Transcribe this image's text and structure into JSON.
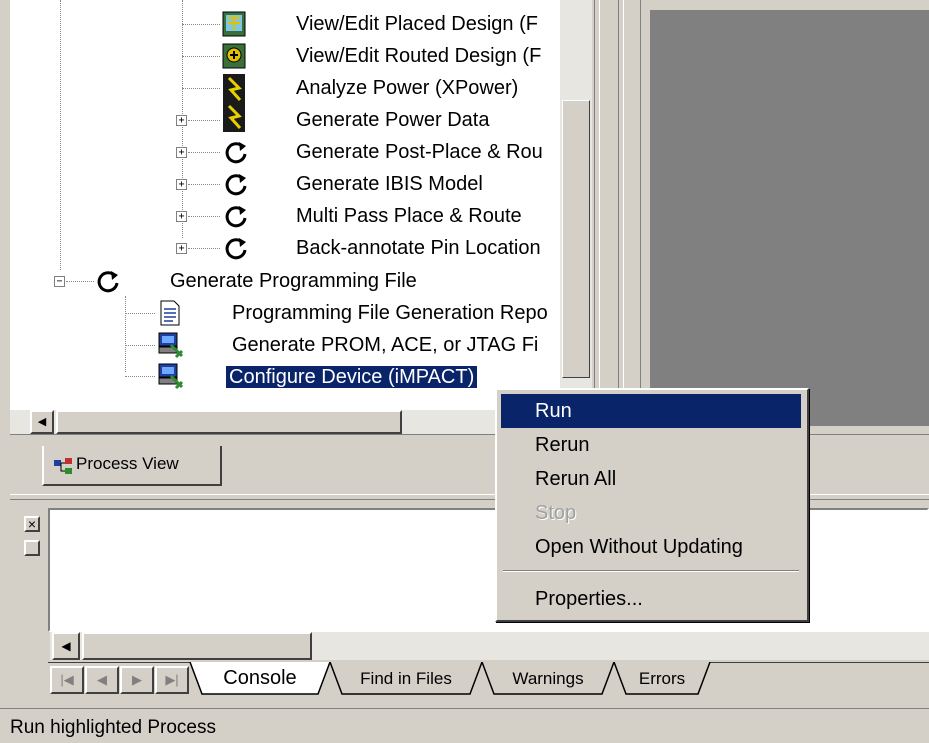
{
  "tree": {
    "items": [
      {
        "label": "View/Edit Placed Design (F",
        "icon": "placed-design-icon"
      },
      {
        "label": "View/Edit Routed Design (F",
        "icon": "routed-design-icon"
      },
      {
        "label": "Analyze Power (XPower)",
        "icon": "xpower-icon"
      },
      {
        "label": "Generate Power Data",
        "icon": "xpower-icon"
      },
      {
        "label": "Generate Post-Place & Rou",
        "icon": "process-icon"
      },
      {
        "label": "Generate IBIS Model",
        "icon": "process-icon"
      },
      {
        "label": "Multi Pass Place & Route",
        "icon": "process-icon"
      },
      {
        "label": "Back-annotate Pin Location",
        "icon": "process-icon"
      },
      {
        "label": "Generate Programming File",
        "icon": "process-icon"
      },
      {
        "label": "Programming File Generation Repo",
        "icon": "report-icon"
      },
      {
        "label": "Generate PROM, ACE, or JTAG Fi",
        "icon": "tool-icon"
      },
      {
        "label": "Configure Device (iMPACT)",
        "icon": "tool-icon"
      }
    ],
    "expanders": {
      "plus": "+",
      "minus": "−"
    }
  },
  "process_view_tab": "Process View",
  "context_menu": {
    "run": "Run",
    "rerun": "Rerun",
    "rerun_all": "Rerun All",
    "stop": "Stop",
    "open_without_updating": "Open Without Updating",
    "properties": "Properties..."
  },
  "console": {
    "close_glyph": "×",
    "nav": {
      "first": "|◀",
      "prev": "◀",
      "next": "▶",
      "last": "▶|"
    },
    "tabs": [
      "Console",
      "Find in Files",
      "Warnings",
      "Errors"
    ]
  },
  "scroll_arrows": {
    "left": "◀"
  },
  "status_bar": "Run highlighted Process",
  "colors": {
    "selection": "#0a246a",
    "face": "#d4d0c8",
    "pane": "#808080"
  }
}
